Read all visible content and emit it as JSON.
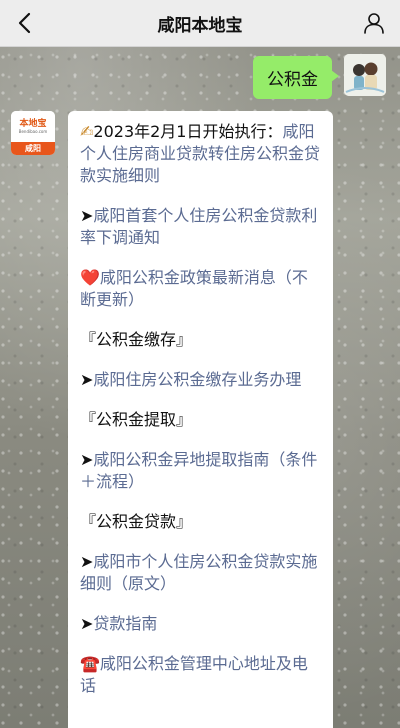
{
  "header": {
    "title": "咸阳本地宝"
  },
  "messages": {
    "outgoing": {
      "text": "公积金"
    },
    "incoming": {
      "avatar": {
        "logo_text": "本地宝",
        "logo_sub": "Bendibao.com",
        "city": "咸阳"
      },
      "items": [
        {
          "type": "link",
          "icon": "✍",
          "lead": "2023年2月1日开始执行：",
          "text": "咸阳个人住房商业贷款转住房公积金贷款实施细则"
        },
        {
          "type": "link",
          "icon": "➤",
          "text": "咸阳首套个人住房公积金贷款利率下调通知"
        },
        {
          "type": "link",
          "icon": "❤️",
          "text": "咸阳公积金政策最新消息（不断更新）"
        },
        {
          "type": "section",
          "text": "『公积金缴存』"
        },
        {
          "type": "link",
          "icon": "➤",
          "text": "咸阳住房公积金缴存业务办理"
        },
        {
          "type": "section",
          "text": "『公积金提取』"
        },
        {
          "type": "link",
          "icon": "➤",
          "text": "咸阳公积金异地提取指南（条件＋流程）"
        },
        {
          "type": "section",
          "text": "『公积金贷款』"
        },
        {
          "type": "link",
          "icon": "➤",
          "text": "咸阳市个人住房公积金贷款实施细则（原文）"
        },
        {
          "type": "link",
          "icon": "➤",
          "text": "贷款指南"
        },
        {
          "type": "link",
          "icon": "☎️",
          "text": "咸阳公积金管理中心地址及电话"
        }
      ]
    }
  },
  "colors": {
    "header_bg": "#ededed",
    "outgoing_bubble": "#95ec69",
    "link": "#5b6b92",
    "accent_orange": "#e8561c"
  }
}
